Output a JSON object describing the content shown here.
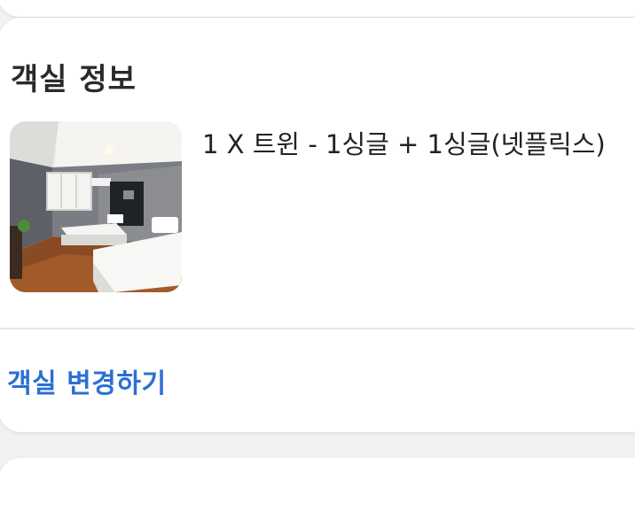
{
  "room_info": {
    "section_title": "객실 정보",
    "room_name": "1 X 트윈 - 1싱글 + 1싱글(넷플릭스)",
    "photo_icon": "room-photo",
    "change_room_label": "객실 변경하기",
    "accent_color": "#2b6fd4"
  }
}
